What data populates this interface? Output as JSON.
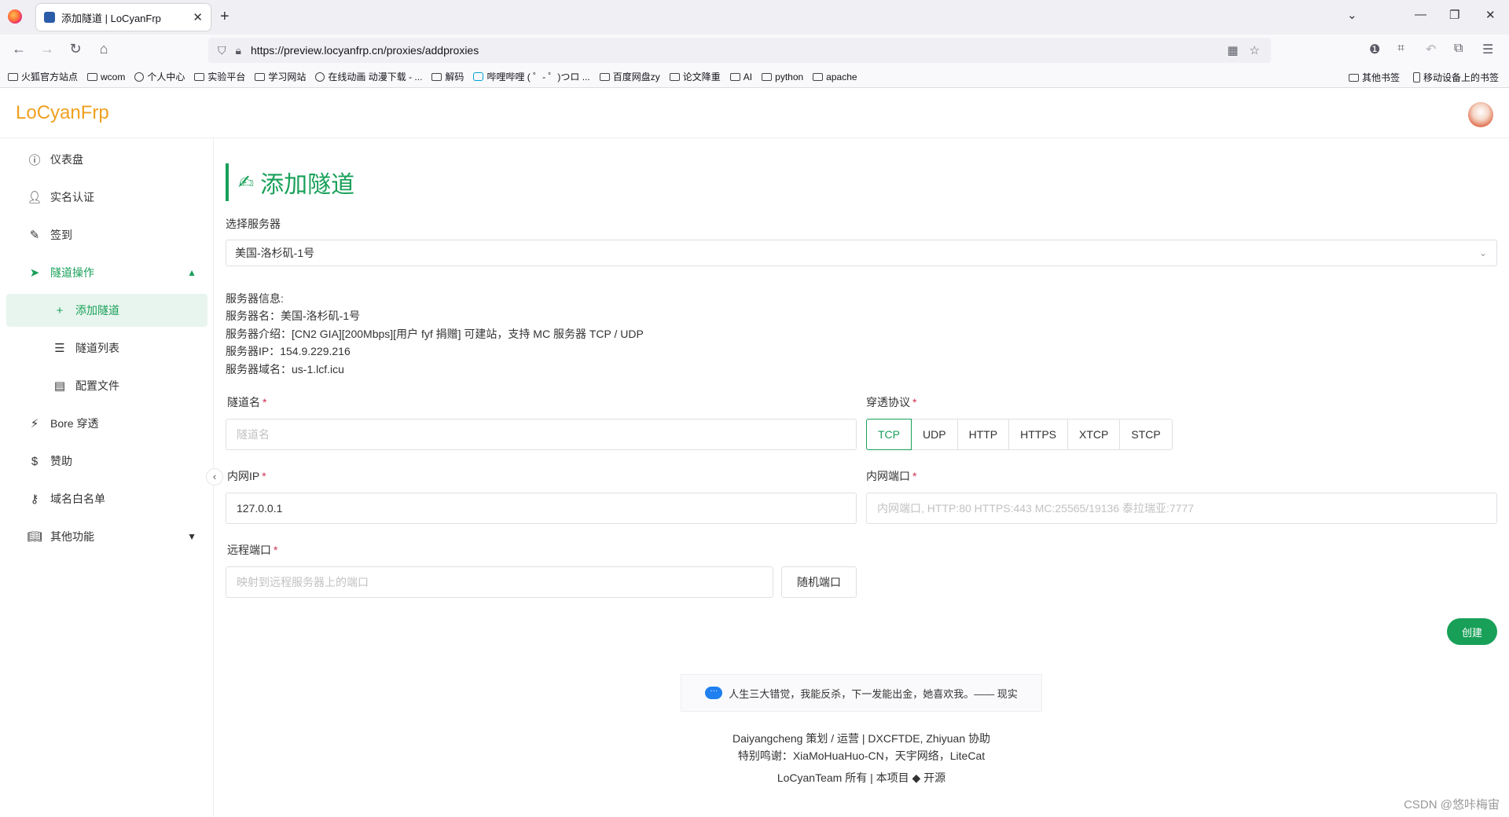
{
  "browser": {
    "tab_title": "添加隧道 | LoCyanFrp",
    "url": "https://preview.locyanfrp.cn/proxies/addproxies",
    "bookmarks": [
      "火狐官方站点",
      "wcom",
      "个人中心",
      "实验平台",
      "学习网站",
      "在线动画 动漫下载 - ...",
      "解码",
      "哔哩哔哩 ( ゜- ゜)つロ ...",
      "百度网盘zy",
      "论文降重",
      "AI",
      "python",
      "apache"
    ],
    "bookmarks_right": [
      "其他书签",
      "移动设备上的书签"
    ]
  },
  "app": {
    "logo": "LoCyanFrp"
  },
  "sidebar": {
    "items": [
      {
        "label": "仪表盘",
        "icon": "info-icon"
      },
      {
        "label": "实名认证",
        "icon": "person-icon"
      },
      {
        "label": "签到",
        "icon": "pen-icon"
      },
      {
        "label": "隧道操作",
        "icon": "send-icon"
      },
      {
        "label": "添加隧道",
        "icon": "plus-icon"
      },
      {
        "label": "隧道列表",
        "icon": "list-icon"
      },
      {
        "label": "配置文件",
        "icon": "file-icon"
      },
      {
        "label": "Bore 穿透",
        "icon": "bolt-icon"
      },
      {
        "label": "赞助",
        "icon": "dollar-icon"
      },
      {
        "label": "域名白名单",
        "icon": "key-icon"
      },
      {
        "label": "其他功能",
        "icon": "book-icon"
      }
    ]
  },
  "main": {
    "title": "添加隧道",
    "server_label": "选择服务器",
    "server_value": "美国-洛杉矶-1号",
    "info": {
      "heading": "服务器信息:",
      "name": "服务器名：美国-洛杉矶-1号",
      "desc": "服务器介绍：[CN2 GIA][200Mbps][用户 fyf 捐赠] 可建站，支持 MC 服务器 TCP / UDP",
      "ip": "服务器IP：154.9.229.216",
      "domain": "服务器域名：us-1.lcf.icu"
    },
    "tunnel_name_label": "隧道名",
    "tunnel_name_placeholder": "隧道名",
    "protocol_label": "穿透协议",
    "protocols": [
      "TCP",
      "UDP",
      "HTTP",
      "HTTPS",
      "XTCP",
      "STCP"
    ],
    "protocol_selected": "TCP",
    "local_ip_label": "内网IP",
    "local_ip_value": "127.0.0.1",
    "local_port_label": "内网端口",
    "local_port_placeholder": "内网端口, HTTP:80 HTTPS:443 MC:25565/19136 泰拉瑞亚:7777",
    "remote_port_label": "远程端口",
    "remote_port_placeholder": "映射到远程服务器上的端口",
    "random_port_button": "随机端口",
    "create_button": "创建",
    "required_mark": "*"
  },
  "footer": {
    "quote": "人生三大错觉，我能反杀，下一发能出金，她喜欢我。—— 现实",
    "line1": "Daiyangcheng 策划 / 运营 | DXCFTDE, Zhiyuan 协助",
    "line2": "特别鸣谢：XiaMoHuaHuo-CN，天宇网络，LiteCat",
    "line3": "LoCyanTeam 所有 | 本项目",
    "line3_link": "开源"
  },
  "watermark": "CSDN @悠咔梅宙",
  "colors": {
    "accent": "#18a058",
    "logo": "#f0a020",
    "required": "#d03050"
  }
}
